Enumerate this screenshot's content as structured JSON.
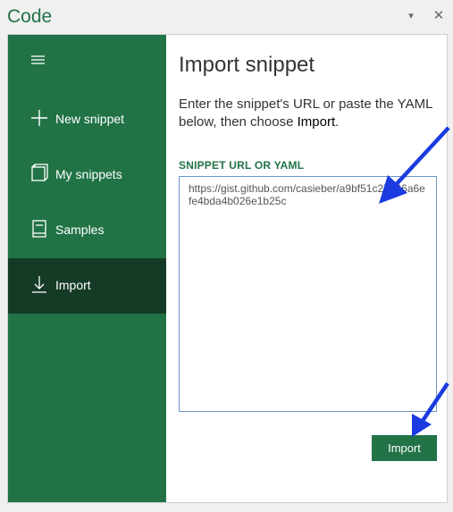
{
  "window": {
    "title": "Code",
    "dropdown_icon": "caret-down-icon",
    "close_icon": "close-icon"
  },
  "sidebar": {
    "menu_icon": "hamburger-icon",
    "items": [
      {
        "label": "New snippet",
        "icon": "plus-icon"
      },
      {
        "label": "My snippets",
        "icon": "snippets-icon"
      },
      {
        "label": "Samples",
        "icon": "samples-icon"
      },
      {
        "label": "Import",
        "icon": "download-icon",
        "active": true
      }
    ]
  },
  "main": {
    "title": "Import snippet",
    "description_prefix": "Enter the snippet's URL or paste the YAML below, then choose ",
    "description_emphasis": "Import",
    "description_suffix": ".",
    "field_label": "SNIPPET URL OR YAML",
    "field_value": "https://gist.github.com/casieber/a9bf51c27546a6efe4bda4b026e1b25c",
    "import_button": "Import"
  },
  "colors": {
    "accent": "#217346",
    "active_nav": "#153b26",
    "annotation_arrow": "#1a3be0"
  }
}
